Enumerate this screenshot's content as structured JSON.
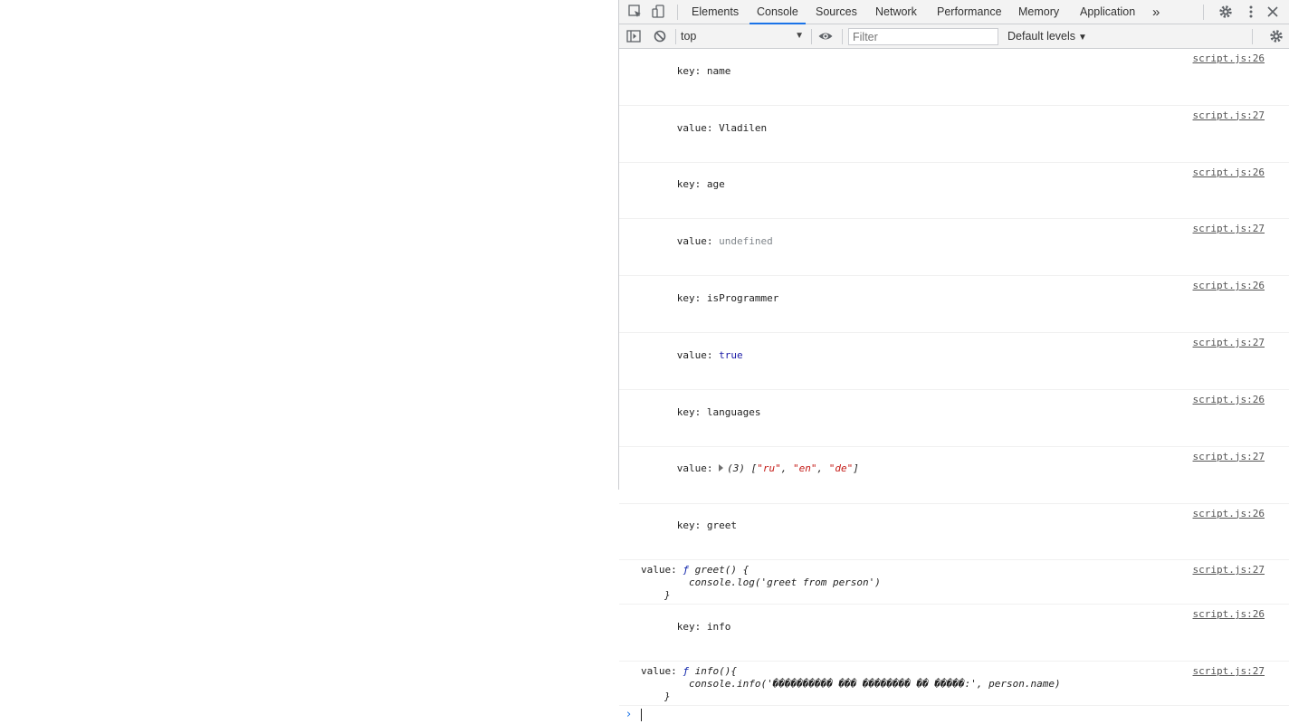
{
  "tabs": [
    {
      "label": "Elements"
    },
    {
      "label": "Console"
    },
    {
      "label": "Sources"
    },
    {
      "label": "Network"
    },
    {
      "label": "Performance"
    },
    {
      "label": "Memory"
    },
    {
      "label": "Application"
    }
  ],
  "more_tabs": "»",
  "toolbar": {
    "context": "top",
    "filter_placeholder": "Filter",
    "levels": "Default levels"
  },
  "messages": [
    {
      "text": "key: name",
      "source": "script.js:26"
    },
    {
      "text": "value: Vladilen",
      "source": "script.js:27"
    },
    {
      "text": "key: age",
      "source": "script.js:26"
    },
    {
      "prefix": "value: ",
      "value": "undefined",
      "source": "script.js:27"
    },
    {
      "text": "key: isProgrammer",
      "source": "script.js:26"
    },
    {
      "prefix": "value: ",
      "value": "true",
      "source": "script.js:27"
    },
    {
      "text": "key: languages",
      "source": "script.js:26"
    },
    {
      "prefix": "value: ",
      "array_len": "(3) [",
      "items": [
        "\"ru\"",
        "\"en\"",
        "\"de\""
      ],
      "array_end": "]",
      "source": "script.js:27"
    },
    {
      "text": "key: greet",
      "source": "script.js:26"
    },
    {
      "prefix": "value: ",
      "fn_kw": "ƒ",
      "fn_sig": " greet() {",
      "fn_body": "console.log('greet from person')",
      "fn_close": "}",
      "source": "script.js:27"
    },
    {
      "text": "key: info",
      "source": "script.js:26"
    },
    {
      "prefix": "value: ",
      "fn_kw": "ƒ",
      "fn_sig": " info(){",
      "fn_body": "console.info('���������� ��� �������� �� �����:', person.name)",
      "fn_close": "}",
      "source": "script.js:27"
    }
  ],
  "prompt": "›"
}
